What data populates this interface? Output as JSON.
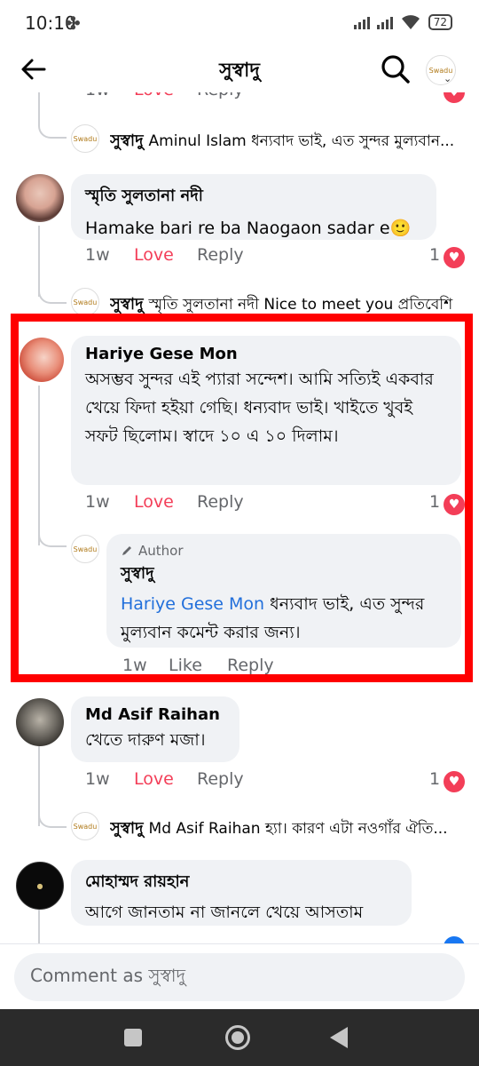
{
  "status": {
    "time": "10:10",
    "battery": "72"
  },
  "header": {
    "title": "সুস্বাদু"
  },
  "comments": [
    {
      "replies": [
        {
          "name": "সুস্বাদু",
          "text": "Aminul Islam ধন্যবাদ ভাই, এত সুন্দর মুল্যবান..."
        }
      ]
    },
    {
      "name": "স্মৃতি সুলতানা নদী",
      "text": "Hamake bari re ba Naogaon sadar e🙂",
      "time": "1w",
      "love": "Love",
      "reply": "Reply",
      "reactions": "1",
      "replies": [
        {
          "name": "সুস্বাদু",
          "text": "স্মৃতি সুলতানা নদী Nice to meet you প্রতিবেশি"
        }
      ]
    },
    {
      "name": "Hariye Gese Mon",
      "text": "অসম্ভব সুন্দর এই প্যারা সন্দেশ। আমি সত্যিই একবার খেয়ে ফিদা হইয়া গেছি। ধন্যবাদ ভাই। খাইতে খুবই সফট ছিলোম। স্বাদে ১০ এ ১০ দিলাম।",
      "time": "1w",
      "love": "Love",
      "reply": "Reply",
      "reactions": "1",
      "author_reply": {
        "tag": "Author",
        "name": "সুস্বাদু",
        "mention": "Hariye Gese Mon",
        "text": " ধন্যবাদ ভাই, এত সুন্দর মুল্যবান কমেন্ট করার জন্য।",
        "time": "1w",
        "like": "Like",
        "reply": "Reply"
      }
    },
    {
      "name": "Md Asif Raihan",
      "text": "খেতে দারুণ মজা।",
      "time": "1w",
      "love": "Love",
      "reply": "Reply",
      "reactions": "1",
      "replies": [
        {
          "name": "সুস্বাদু",
          "text": "Md Asif Raihan হ্যা। কারণ এটা নওগাঁর ঐতি..."
        }
      ]
    },
    {
      "name": "মোহাম্মদ রায়হান",
      "text": "আগে জানতাম না জানলে খেয়ে আসতাম"
    }
  ],
  "composer": {
    "placeholder": "Comment as সুস্বাদু"
  },
  "colors": {
    "love": "#f33e58",
    "link": "#216fdb",
    "highlight": "#ff0000",
    "bubble": "#f0f2f5"
  },
  "icons": [
    "back-arrow-icon",
    "search-icon",
    "heart-reaction-icon",
    "pencil-icon"
  ]
}
